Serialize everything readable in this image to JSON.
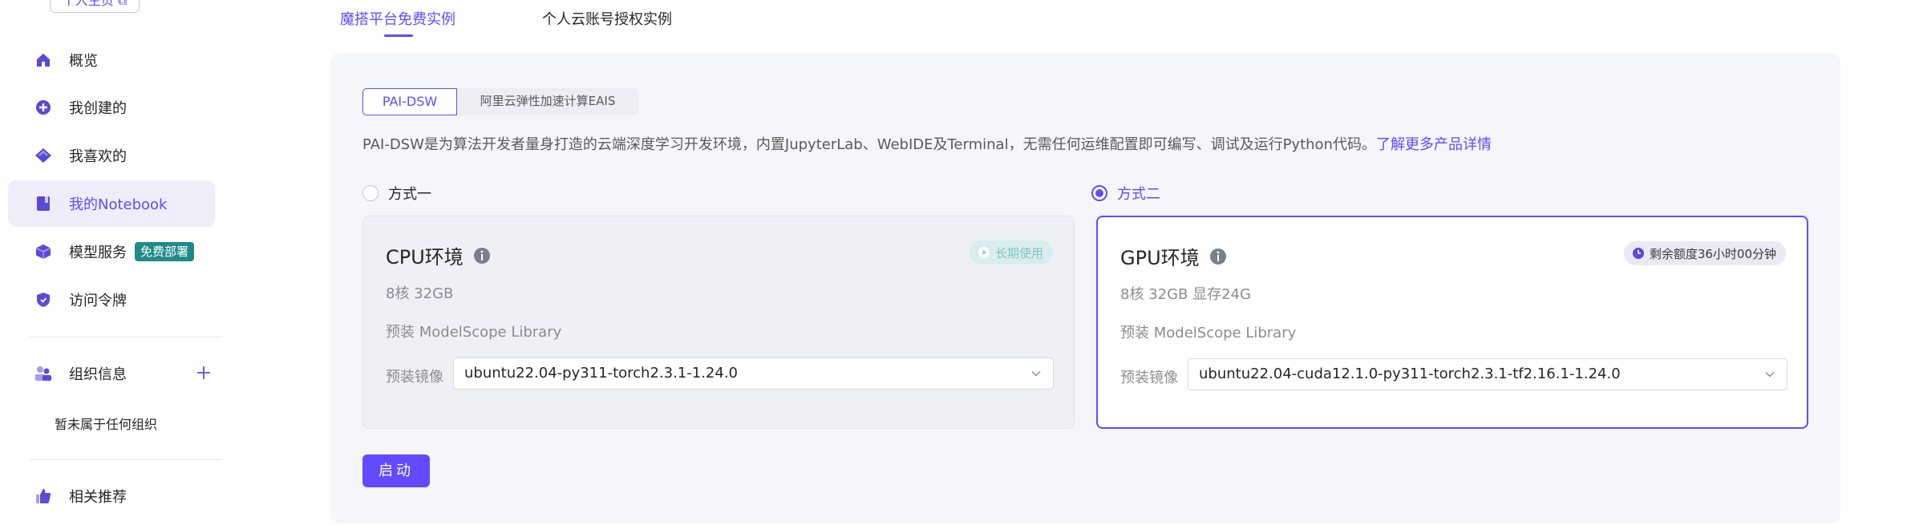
{
  "sidebar": {
    "top_button": "个人主页 ⧉",
    "items": [
      {
        "label": "概览",
        "icon": "home-icon"
      },
      {
        "label": "我创建的",
        "icon": "plus-circle-icon"
      },
      {
        "label": "我喜欢的",
        "icon": "diamond-icon"
      },
      {
        "label": "我的Notebook",
        "icon": "book-icon",
        "active": true
      },
      {
        "label": "模型服务",
        "icon": "cube-icon",
        "badge": "免费部署"
      },
      {
        "label": "访问令牌",
        "icon": "shield-icon"
      }
    ],
    "org": {
      "label": "组织信息",
      "icon": "org-icon",
      "empty_text": "暂未属于任何组织"
    },
    "recommend": {
      "label": "相关推荐",
      "icon": "thumbs-up-icon"
    }
  },
  "tabs": [
    {
      "label": "魔搭平台免费实例",
      "active": true
    },
    {
      "label": "个人云账号授权实例",
      "active": false
    }
  ],
  "segment": [
    {
      "label": "PAI-DSW",
      "active": true
    },
    {
      "label": "阿里云弹性加速计算EAIS",
      "active": false
    }
  ],
  "description": {
    "text": "PAI-DSW是为算法开发者量身打造的云端深度学习开发环境，内置JupyterLab、WebIDE及Terminal，无需任何运维配置即可编写、调试及运行Python代码。",
    "link": "了解更多产品详情"
  },
  "options": [
    {
      "radio_label": "方式一",
      "selected": false,
      "title": "CPU环境",
      "pill": "长期使用",
      "spec": "8核 32GB",
      "library": "预装 ModelScope Library",
      "image_label": "预装镜像",
      "image_value": "ubuntu22.04-py311-torch2.3.1-1.24.0"
    },
    {
      "radio_label": "方式二",
      "selected": true,
      "title": "GPU环境",
      "pill": "剩余额度36小时00分钟",
      "spec": "8核 32GB 显存24G",
      "library": "预装 ModelScope Library",
      "image_label": "预装镜像",
      "image_value": "ubuntu22.04-cuda12.1.0-py311-torch2.3.1-tf2.16.1-1.24.0"
    }
  ],
  "start_button": "启动",
  "colors": {
    "accent": "#624aff",
    "badge": "#1f8a88",
    "panel_bg": "#f5f6fa"
  }
}
